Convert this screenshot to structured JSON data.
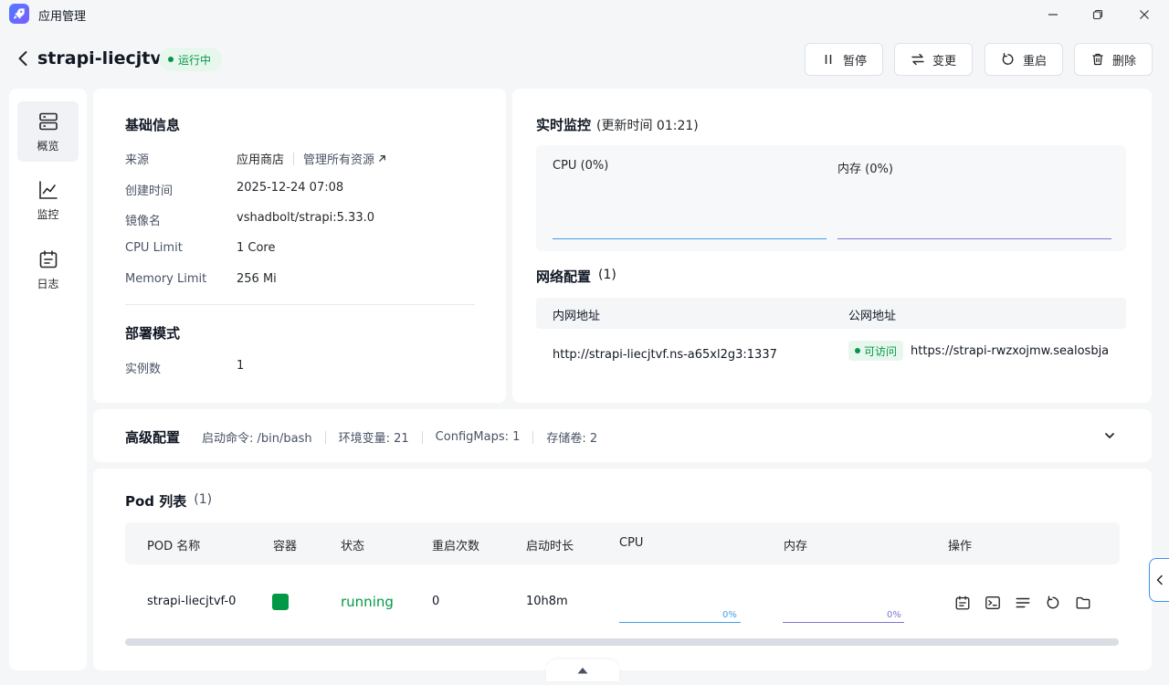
{
  "window": {
    "title": "应用管理",
    "icons": [
      "rocket-icon",
      "minimize-icon",
      "restore-icon",
      "close-icon"
    ]
  },
  "header": {
    "app_name": "strapi-liecjtvf",
    "status": "运行中",
    "actions": {
      "pause": "暂停",
      "change": "变更",
      "restart": "重启",
      "delete": "删除"
    }
  },
  "sidebar": {
    "items": [
      {
        "label": "概览",
        "icon": "server-icon",
        "active": true
      },
      {
        "label": "监控",
        "icon": "chart-line-icon",
        "active": false
      },
      {
        "label": "日志",
        "icon": "calendar-log-icon",
        "active": false
      }
    ]
  },
  "basic_info": {
    "title": "基础信息",
    "source_label": "来源",
    "source_value": "应用商店",
    "manage_link": "管理所有资源",
    "created_label": "创建时间",
    "created_value": "2025-12-24 07:08",
    "image_label": "镜像名",
    "image_value": "vshadbolt/strapi:5.33.0",
    "cpu_label": "CPU Limit",
    "cpu_value": "1 Core",
    "mem_label": "Memory Limit",
    "mem_value": "256 Mi"
  },
  "deploy": {
    "title": "部署模式",
    "instances_label": "实例数",
    "instances_value": "1"
  },
  "monitor": {
    "title": "实时监控",
    "update_time": "(更新时间  01:21)",
    "cpu_label": "CPU",
    "cpu_pct": "(0%)",
    "mem_label": "内存",
    "mem_pct": "(0%)",
    "cpu_color": "#3e9eea",
    "mem_color": "#7a77d8"
  },
  "network": {
    "title": "网络配置",
    "count": "(1)",
    "col_internal": "内网地址",
    "col_public": "公网地址",
    "internal_addr": "http://strapi-liecjtvf.ns-a65xl2g3:1337",
    "public_status": "可访问",
    "public_addr": "https://strapi-rwzxojmw.sealosbja.si"
  },
  "advanced": {
    "title": "高级配置",
    "start_cmd": "启动命令: /bin/bash",
    "env_vars": "环境变量: 21",
    "configmaps": "ConfigMaps: 1",
    "volumes": "存储卷: 2"
  },
  "pods": {
    "title": "Pod 列表",
    "count": "(1)",
    "columns": {
      "name": "POD 名称",
      "container": "容器",
      "status": "状态",
      "restarts": "重启次数",
      "uptime": "启动时长",
      "cpu": "CPU",
      "mem": "内存",
      "ops": "操作"
    },
    "rows": [
      {
        "name": "strapi-liecjtvf-0",
        "status": "running",
        "restarts": "0",
        "uptime": "10h8m",
        "cpu_pct": "0%",
        "mem_pct": "0%"
      }
    ],
    "container_color": "#039845",
    "running_color": "#039845"
  }
}
